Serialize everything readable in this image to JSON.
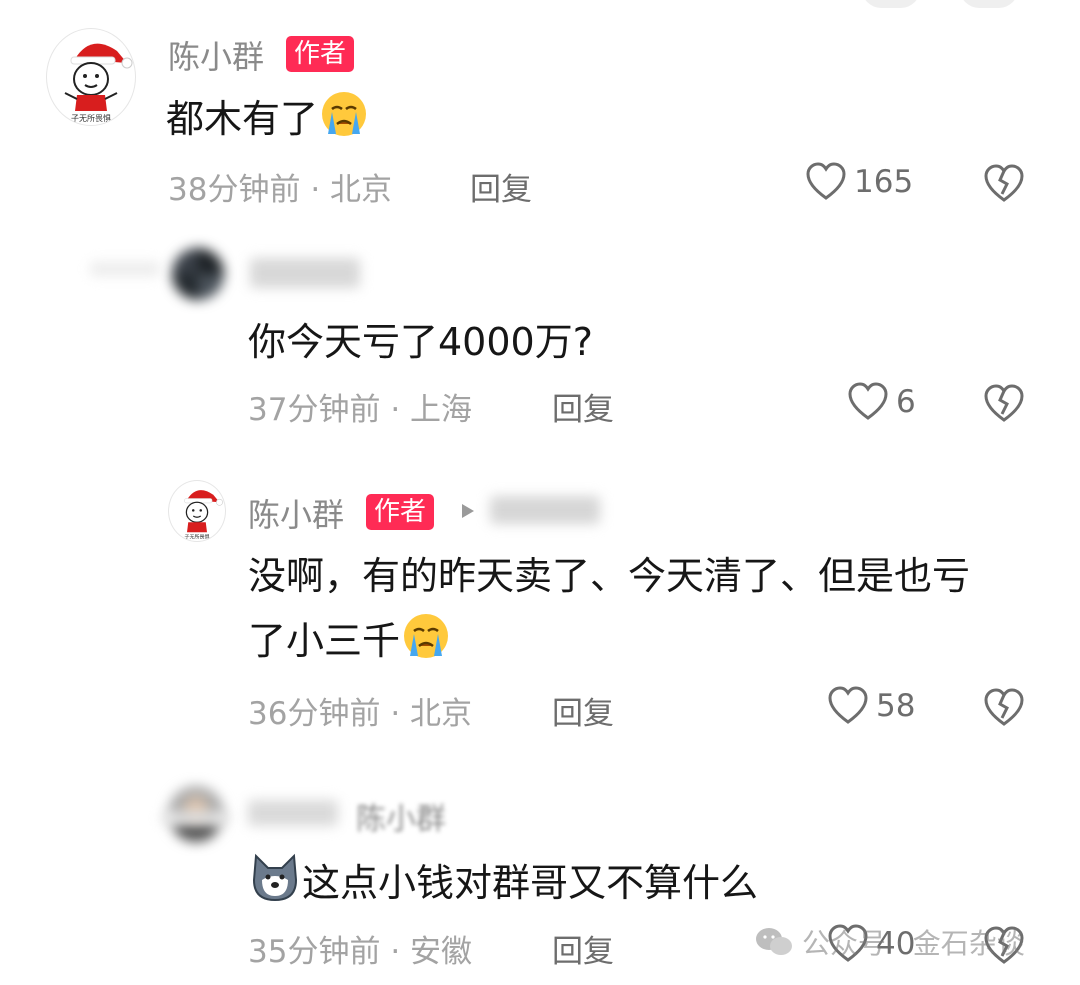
{
  "comments": [
    {
      "name": "陈小群",
      "badge": "作者",
      "avatar_caption": "子无所畏惧",
      "text": "都木有了",
      "time": "38分钟前",
      "location": "北京",
      "reply_label": "回复",
      "likes": "165"
    },
    {
      "name": "",
      "text": "你今天亏了4000万?",
      "time": "37分钟前",
      "location": "上海",
      "reply_label": "回复",
      "likes": "6"
    },
    {
      "name": "陈小群",
      "badge": "作者",
      "avatar_caption": "子无所畏惧",
      "text_line1": "没啊，有的昨天卖了、今天清了、但是也亏",
      "text_line2": "了小三千",
      "time": "36分钟前",
      "location": "北京",
      "reply_label": "回复",
      "likes": "58"
    },
    {
      "reply_target": "陈小群",
      "text": "这点小钱对群哥又不算什么",
      "time": "35分钟前",
      "location": "安徽",
      "reply_label": "回复",
      "likes": "40"
    }
  ],
  "separator": "·",
  "watermark": {
    "text": "公众号 · 金石杂谈"
  },
  "colors": {
    "badge": "#ff2b55",
    "meta": "#a3a3a3",
    "text": "#161616"
  }
}
